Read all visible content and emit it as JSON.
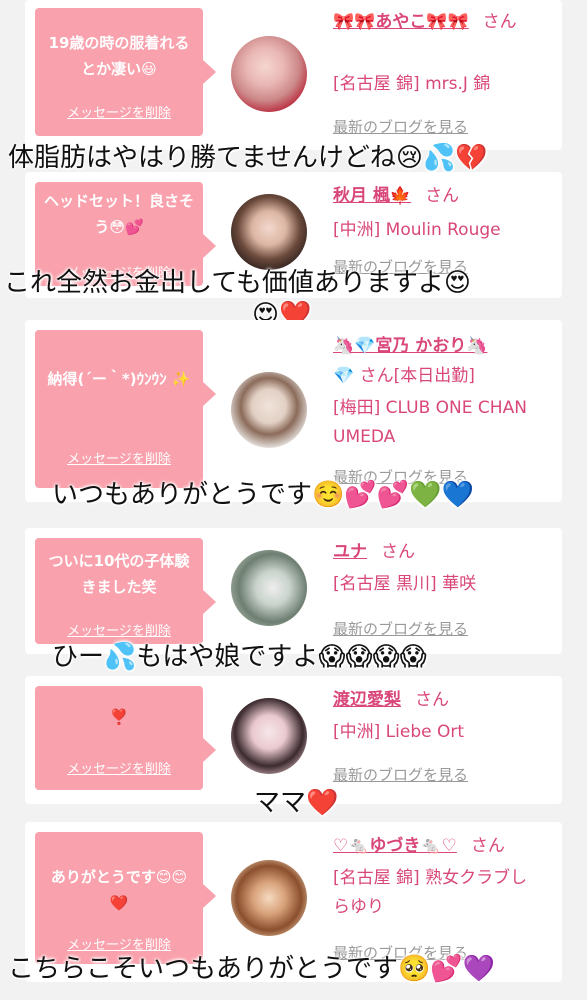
{
  "cards": [
    {
      "message": "19歳の時の服着れるとか凄い😃",
      "delete_label": "メッセージを削除",
      "name": "🎀🎀あやこ🎀🎀",
      "san": "さん",
      "shop": "[名古屋 錦] mrs.J 錦",
      "blog_label": "最新のブログを見る",
      "overlay": "体脂肪はやはり勝てませんけどね😢💦💔"
    },
    {
      "message": "ヘッドセット！良さそう😳💕",
      "delete_label": "メッセージを削除",
      "name": "秋月 楓🍁",
      "san": "さん",
      "shop": "[中洲] Moulin Rouge",
      "blog_label": "最新のブログを見る",
      "overlay": "これ全然お金出しても価値ありますよ😍",
      "overlay2": "😍❤️"
    },
    {
      "message": "納得(´ー｀*)ｳﾝｳﾝ ✨",
      "delete_label": "メッセージを削除",
      "name": "🦄💎宮乃 かおり🦄",
      "san": "💎 さん[本日出勤]",
      "shop": "[梅田] CLUB ONE CHAN UMEDA",
      "blog_label": "最新のブログを見る",
      "overlay": "いつもありがとうです☺️💕💕💚💙"
    },
    {
      "message": "ついに10代の子体験きました笑",
      "delete_label": "メッセージを削除",
      "name": "ユナ",
      "san": "さん",
      "shop": "[名古屋 黒川] 華咲",
      "blog_label": "最新のブログを見る",
      "overlay": "ひー💦もはや娘ですよ😱😱😱😱"
    },
    {
      "message": "❣️",
      "delete_label": "メッセージを削除",
      "name": "渡辺愛梨",
      "san": "さん",
      "shop": "[中洲] Liebe Ort",
      "blog_label": "最新のブログを見る",
      "overlay": "ママ❤️"
    },
    {
      "message": "ありがとうです😊😊❤️",
      "delete_label": "メッセージを削除",
      "name": "♡🐁ゆづき🐁♡",
      "san": "さん",
      "shop": "[名古屋 錦] 熟女クラブしらゆり",
      "blog_label": "最新のブログを見る",
      "overlay": "こちらこそいつもありがとうです🥺💕💜"
    }
  ],
  "colors": {
    "accent": "#d9477a",
    "bubble": "#f9a1ac",
    "background": "#f2f2f2"
  }
}
